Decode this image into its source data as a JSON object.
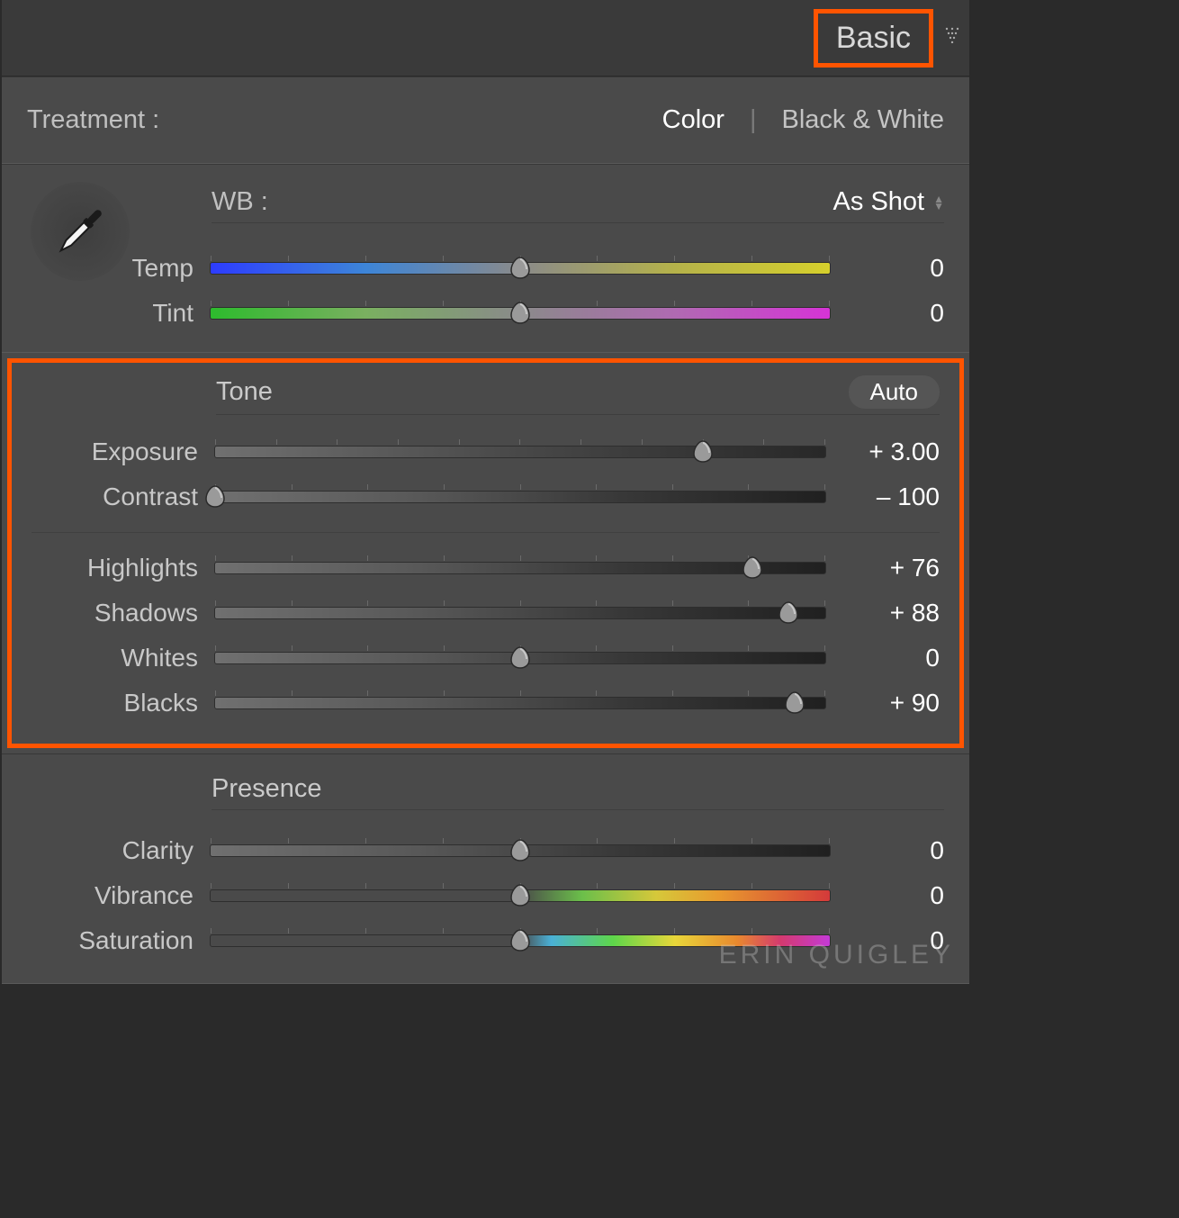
{
  "panel": {
    "title": "Basic"
  },
  "treatment": {
    "label": "Treatment :",
    "color": "Color",
    "bw": "Black & White"
  },
  "wb": {
    "label": "WB :",
    "selected": "As Shot",
    "temp": {
      "label": "Temp",
      "value": "0",
      "pos": 50
    },
    "tint": {
      "label": "Tint",
      "value": "0",
      "pos": 50
    }
  },
  "tone": {
    "heading": "Tone",
    "auto": "Auto",
    "exposure": {
      "label": "Exposure",
      "value": "+ 3.00",
      "pos": 80
    },
    "contrast": {
      "label": "Contrast",
      "value": "– 100",
      "pos": 0
    },
    "highlights": {
      "label": "Highlights",
      "value": "+ 76",
      "pos": 88
    },
    "shadows": {
      "label": "Shadows",
      "value": "+ 88",
      "pos": 94
    },
    "whites": {
      "label": "Whites",
      "value": "0",
      "pos": 50
    },
    "blacks": {
      "label": "Blacks",
      "value": "+ 90",
      "pos": 95
    }
  },
  "presence": {
    "heading": "Presence",
    "clarity": {
      "label": "Clarity",
      "value": "0",
      "pos": 50
    },
    "vibrance": {
      "label": "Vibrance",
      "value": "0",
      "pos": 50
    },
    "saturation": {
      "label": "Saturation",
      "value": "0",
      "pos": 50
    }
  },
  "watermark": "ERIN QUIGLEY"
}
